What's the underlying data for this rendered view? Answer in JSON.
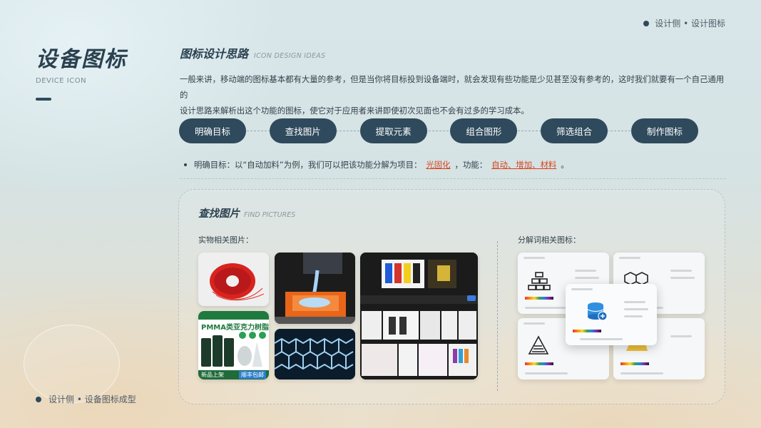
{
  "header": {
    "breadcrumb": "设计侧 • 设计图标"
  },
  "sidebar": {
    "title_cn": "设备图标",
    "title_en": "DEVICE ICON",
    "footer": "设计侧 • 设备图标成型"
  },
  "section": {
    "title_cn": "图标设计思路",
    "title_en": "ICON DESIGN IDEAS",
    "intro_line1": "一般来讲，移动端的图标基本都有大量的参考，但是当你将目标投到设备端时，就会发现有些功能是少见甚至没有参考的，这时我们就要有一个自己通用的",
    "intro_line2": "设计思路来解析出这个功能的图标，使它对于应用者来讲即使初次见面也不会有过多的学习成本。"
  },
  "steps": [
    "明确目标",
    "查找图片",
    "提取元素",
    "组合图形",
    "筛选组合",
    "制作图标"
  ],
  "goal": {
    "prefix": "明确目标：以“自动加料”为例，我们可以把该功能分解为项目：",
    "project": "光固化",
    "middle": "，功能：",
    "functions": "自动、增加、材料",
    "suffix": "。"
  },
  "panel": {
    "title_cn": "查找图片",
    "title_en": "FIND PICTURES",
    "left_label": "实物相关图片：",
    "right_label": "分解词相关图标：",
    "pmma_title": "PMMA类亚克力树脂",
    "pmma_new": "新品上架",
    "pmma_ship": "顺丰包邮"
  },
  "colors": {
    "accent": "#2f4a5c",
    "highlight": "#d9431c"
  }
}
